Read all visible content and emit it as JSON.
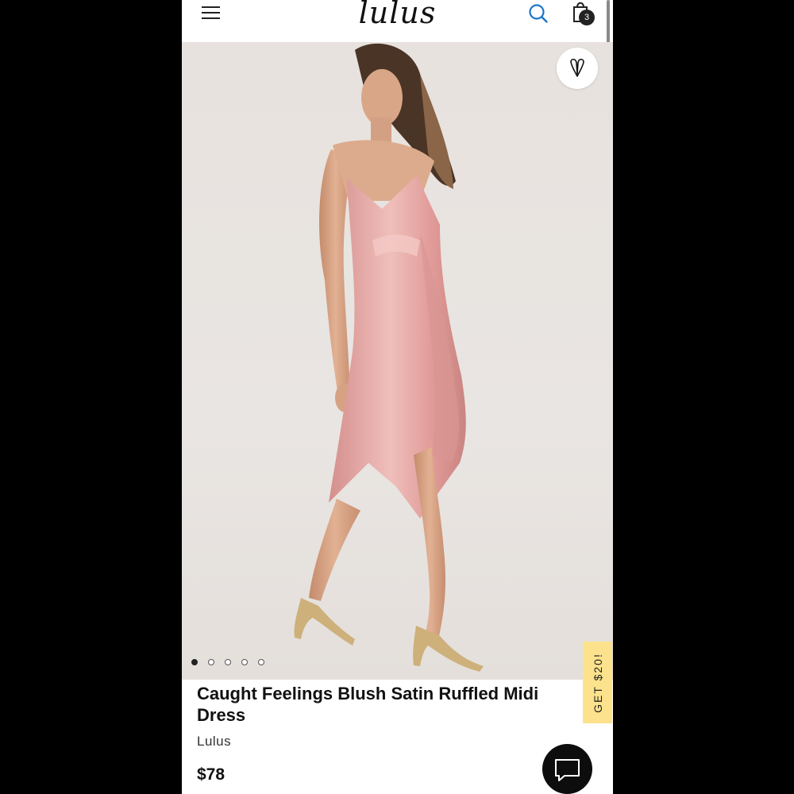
{
  "header": {
    "logo_text": "lulus",
    "cart_count": "3",
    "icons": [
      "hamburger-menu-icon",
      "search-icon",
      "shopping-bag-icon"
    ]
  },
  "hero": {
    "image_description_icon": "product-photo",
    "carousel_dots": 5,
    "active_dot": 0,
    "favorite_icon": "heart-icon"
  },
  "promo": {
    "label": "GET $20!"
  },
  "product": {
    "title": "Caught Feelings Blush Satin Ruffled Midi Dress",
    "brand": "Lulus",
    "price": "$78"
  },
  "chat": {
    "icon": "chat-bubble-icon"
  },
  "colors": {
    "accent_blue": "#1b76c9",
    "promo_yellow": "#fce28c",
    "dress_pink": "#e3a5a2"
  }
}
